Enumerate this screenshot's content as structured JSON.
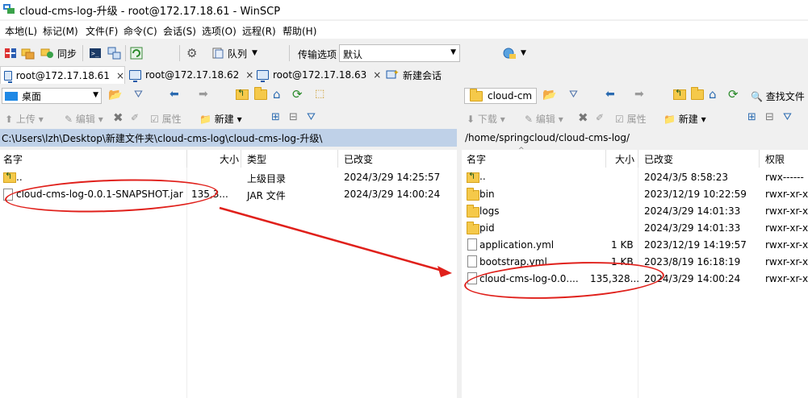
{
  "window": {
    "title": "cloud-cms-log-升级 - root@172.17.18.61 - WinSCP"
  },
  "menu": [
    "本地(L)",
    "标记(M)",
    "文件(F)",
    "命令(C)",
    "会话(S)",
    "选项(O)",
    "远程(R)",
    "帮助(H)"
  ],
  "toolbar": {
    "sync_label": "同步",
    "queue_label": "队列",
    "transfer_options_label": "传输选项",
    "transfer_preset": "默认"
  },
  "tabs": [
    {
      "label": "root@172.17.18.61",
      "active": true
    },
    {
      "label": "root@172.17.18.62",
      "active": false
    },
    {
      "label": "root@172.17.18.63",
      "active": false
    }
  ],
  "new_session_label": "新建会话",
  "close_glyph": "×",
  "local": {
    "drive": "桌面",
    "actions": {
      "upload": "上传",
      "edit": "编辑",
      "properties": "属性",
      "new": "新建"
    },
    "path": "C:\\Users\\lzh\\Desktop\\新建文件夹\\cloud-cms-log\\cloud-cms-log-升级\\",
    "columns": {
      "name": "名字",
      "size": "大小",
      "type": "类型",
      "changed": "已改变"
    },
    "rows": [
      {
        "name": "..",
        "size": "",
        "type": "上级目录",
        "changed": "2024/3/29   14:25:57",
        "kind": "up"
      },
      {
        "name": "cloud-cms-log-0.0.1-SNAPSHOT.jar",
        "size": "135,3...",
        "type": "JAR 文件",
        "changed": "2024/3/29   14:00:24",
        "kind": "file"
      }
    ]
  },
  "remote": {
    "drive": "cloud-cm",
    "actions": {
      "download": "下载",
      "edit": "编辑",
      "properties": "属性",
      "new": "新建"
    },
    "find_files": "查找文件",
    "path": "/home/springcloud/cloud-cms-log/",
    "columns": {
      "name": "名字",
      "size": "大小",
      "changed": "已改变",
      "rights": "权限"
    },
    "rows": [
      {
        "name": "..",
        "size": "",
        "changed": "2024/3/5 8:58:23",
        "rights": "rwx------",
        "kind": "up"
      },
      {
        "name": "bin",
        "size": "",
        "changed": "2023/12/19 10:22:59",
        "rights": "rwxr-xr-x",
        "kind": "folder"
      },
      {
        "name": "logs",
        "size": "",
        "changed": "2024/3/29 14:01:33",
        "rights": "rwxr-xr-x",
        "kind": "folder"
      },
      {
        "name": "pid",
        "size": "",
        "changed": "2024/3/29 14:01:33",
        "rights": "rwxr-xr-x",
        "kind": "folder"
      },
      {
        "name": "application.yml",
        "size": "1 KB",
        "changed": "2023/12/19 14:19:57",
        "rights": "rwxr-xr-x",
        "kind": "file"
      },
      {
        "name": "bootstrap.yml",
        "size": "1 KB",
        "changed": "2023/8/19 16:18:19",
        "rights": "rwxr-xr-x",
        "kind": "file"
      },
      {
        "name": "cloud-cms-log-0.0....",
        "size": "135,328...",
        "changed": "2024/3/29 14:00:24",
        "rights": "rwxr-xr-x",
        "kind": "file"
      }
    ]
  },
  "colors": {
    "path_bar_active": "#bfd1e8",
    "path_bar_inactive": "#f0f0f0",
    "annotation": "#e0201b"
  }
}
